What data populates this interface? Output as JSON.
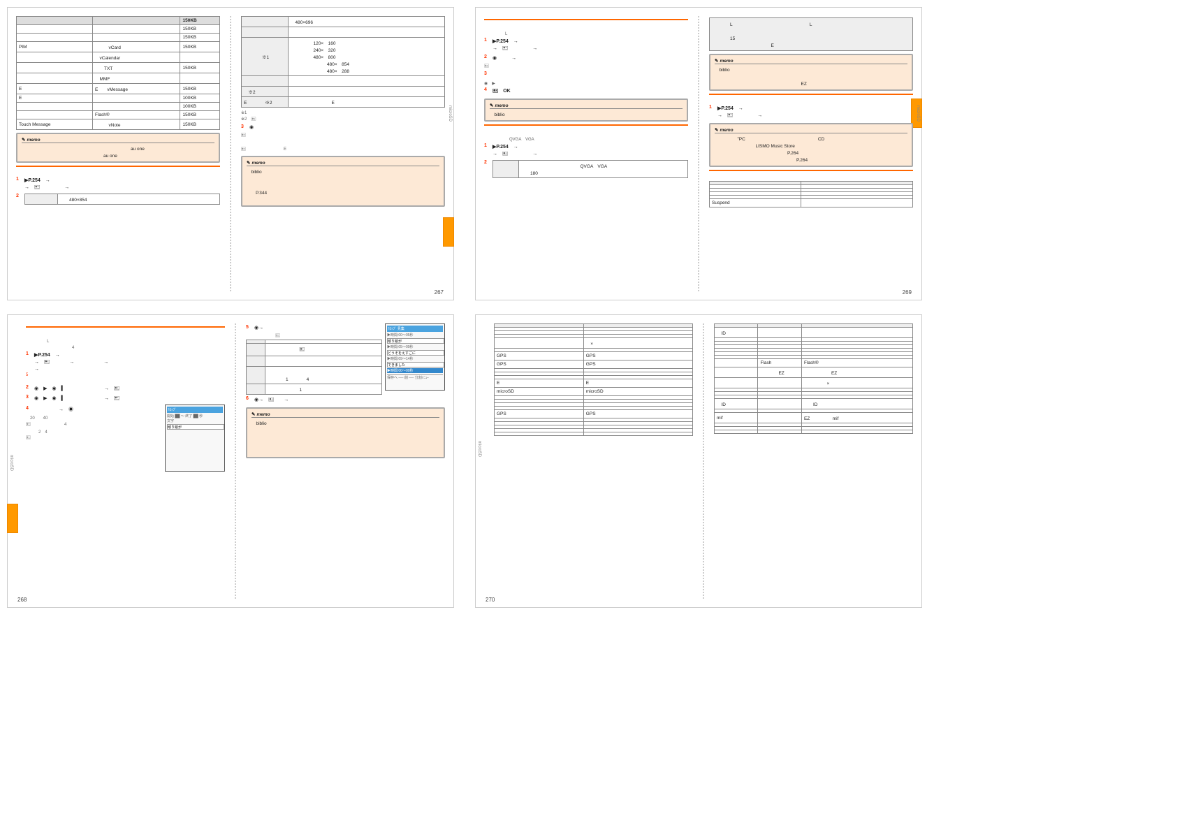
{
  "sidelabel": "microSD",
  "p": {
    "267": "267",
    "268": "268",
    "269": "269",
    "270": "270"
  },
  "memo_label": "memo",
  "t1": {
    "hdr": [
      "",
      "",
      "150KB"
    ],
    "rows": [
      [
        "",
        "",
        "150KB"
      ],
      [
        "",
        "",
        "150KB"
      ],
      [
        "PIM",
        "　　　vCard　",
        "150KB"
      ],
      [
        "",
        "　vCalendar　",
        ""
      ],
      [
        "",
        "　　TXT　",
        "150KB"
      ],
      [
        "",
        "　MMF　",
        ""
      ],
      [
        "E",
        "E　　vMessage　",
        "150KB"
      ],
      [
        "E",
        "",
        "100KB"
      ],
      [
        "",
        "",
        "100KB"
      ],
      [
        "",
        "Flash®",
        "150KB"
      ],
      [
        "Touch Message",
        "　　　vNote　",
        "150KB"
      ]
    ]
  },
  "m1": "　　　　　　　　　　　　　　　　　　　　　　　　au one　\n　　　　　　　　　　　　　　　　　　au one",
  "s254": "▶P.254　→",
  "arrow_icon": "→　🖭",
  "p1_s2_res": "　　480×854",
  "t2": {
    "r1": [
      "",
      "　480×696"
    ],
    "r2": [
      "",
      "　"
    ],
    "r3": [
      "　　　　※1",
      "　　　　　120×　160\n　　　　　240×　320\n　　　　　480×　800\n　　　　　　　　480×　854\n　　　　　　　　480×　288"
    ],
    "r4": [
      "",
      "　"
    ],
    "r5": [
      "　※2",
      "　"
    ],
    "r6": [
      "E　　　　※2",
      "　　　　　　　　　E"
    ]
  },
  "foot12": "※1　　　　　　　　　　　　　　　　　　\n※2　🖭",
  "p1_s3": "◉",
  "p1_s3_body": "🖭　　　　　　　　　　\n　\n🖭　　　　　　　　　E",
  "m2": "　biblio　\n　\n　\n　　P.344　\n　",
  "p2_s1": "▶P.254　→",
  "p2_s2": "◉　　　→　",
  "p2_s3": "　",
  "p2_s3b": "◉　▶",
  "p2_s4": "🖭　OK　",
  "m3": "　biblio　",
  "p2_qvga": "　　　　　　QVGA　VGA",
  "p2_b_s2": "　　　　　　　　　　　　　QVGA　VGA　\n　　180",
  "p2_tbox": "　　　　L　　　　　　　　　　　　　　　　　L　\n　\n　　　　15　\n　　　　　　　　　　　　　E",
  "m4": "　biblio　\n　\n　　　　　　　　　　　　　　　　　　　EZ",
  "m5": "　　　　　\"PC　　　　　　　　　　　　　　　　CD　\n　　　　　　　　　LISMO Music Store　\n　　　　　　　　　　　　　　　　P.264　\n　　　　　　　　　　　　　　　　　　P.264",
  "t3": {
    "rows": [
      [
        "",
        ""
      ],
      [
        "",
        ""
      ],
      [
        "",
        ""
      ],
      [
        "",
        ""
      ],
      [
        "Suspend",
        ""
      ]
    ]
  },
  "p3_intro": "　　　　　L　\n　　　　　　　　　　　4",
  "p3_s1": "▶P.254　→",
  "p3_o5": "5",
  "p3_s2": "◉　▶　◉　▍　　　　　　　　→　🖭",
  "p3_s3": "◉　▶　◉　▍　　　　　　　　→　🖭",
  "p3_s4": "　　　　　→　◉",
  "p3_s4b": "　20　　40　\n🖭　　　　　　　　4　\n　　　2　4　\n🖭",
  "p3_s5": "◉→",
  "p3_s5b": "　　　　　　　🖭",
  "p3_t": {
    "rows": [
      [
        "",
        ""
      ],
      [
        "",
        "　　　　　　　🖭　"
      ],
      [
        "",
        "　"
      ],
      [
        "",
        "　\n　　　　1　　　　4"
      ],
      [
        "",
        "　　　　　　　1"
      ]
    ]
  },
  "p3_s6": "◉→　🖭　　→",
  "m6": "　biblio　\n　\n　\n　\n　",
  "thumb1": {
    "t": "ﾃﾛｯﾌﾟ",
    "a": "開始 ██ ～ 終了 ██ 秒",
    "l": "文字",
    "v": "頑り絵が"
  },
  "thumb2": {
    "t": "ﾃﾛｯﾌﾟ 見集",
    "r1": "▶時間:00～05秒",
    "v1": "頑り絵が",
    "r2": "▶時間:05～09秒",
    "v2": "どうそをえすごに",
    "r3": "▶時間:09～14秒",
    "v3": "できました",
    "r4": "▶時間:00～00秒",
    "f": "保存へ ── 削 ── 分割ﾒﾆｭｰ"
  },
  "t4": {
    "rows": [
      [
        "",
        ""
      ],
      [
        "",
        ""
      ],
      [
        "",
        ""
      ],
      [
        "",
        "　×"
      ],
      [
        "",
        ""
      ],
      [
        "GPS",
        "GPS"
      ],
      [
        "GPS",
        "GPS"
      ],
      [
        "",
        ""
      ],
      [
        "",
        ""
      ],
      [
        "",
        ""
      ],
      [
        "E",
        "E"
      ],
      [
        "microSD",
        "microSD"
      ],
      [
        "",
        ""
      ],
      [
        "",
        ""
      ],
      [
        "",
        ""
      ],
      [
        "",
        ""
      ],
      [
        "GPS",
        "GPS"
      ],
      [
        "",
        ""
      ],
      [
        "",
        ""
      ],
      [
        "",
        ""
      ],
      [
        "",
        ""
      ],
      [
        "",
        ""
      ]
    ]
  },
  "t5": {
    "rows": [
      [
        "　ID",
        "",
        ""
      ],
      [
        "",
        "",
        ""
      ],
      [
        "",
        "",
        ""
      ],
      [
        "",
        "",
        ""
      ],
      [
        "",
        "",
        ""
      ],
      [
        "",
        "",
        ""
      ],
      [
        "",
        "",
        ""
      ],
      [
        "",
        "Flash",
        "Flash®"
      ],
      [
        "",
        "　　　　EZ",
        "　　　　　　EZ"
      ],
      [
        "",
        "",
        "　　　　　×"
      ],
      [
        "",
        "",
        ""
      ],
      [
        "",
        "",
        ""
      ],
      [
        "",
        "",
        ""
      ],
      [
        "　ID",
        "",
        "　　ID"
      ],
      [
        "",
        "",
        ""
      ],
      [
        "mif",
        "",
        "EZ　　　　　mif"
      ],
      [
        "",
        "",
        ""
      ],
      [
        "",
        "",
        ""
      ],
      [
        "",
        "",
        ""
      ]
    ]
  }
}
